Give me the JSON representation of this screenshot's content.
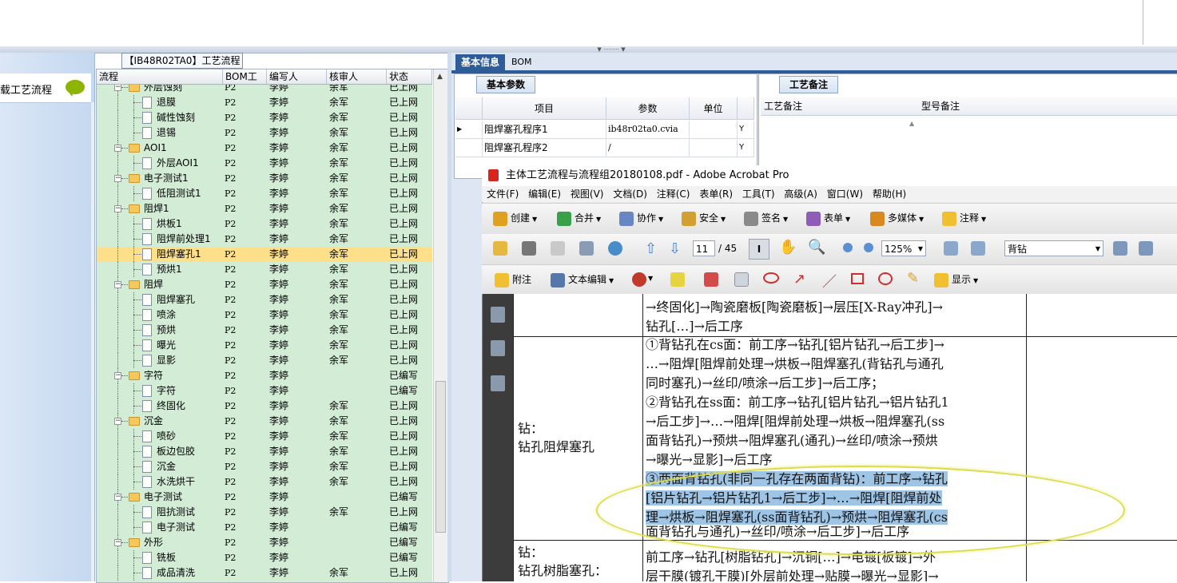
{
  "process_grid": {
    "title": "【IB48R02TA0】工艺流程",
    "left_item_label": "载工艺流程",
    "columns": [
      "流程",
      "BOM工厂",
      "编写人",
      "核审人",
      "状态"
    ],
    "rows": [
      {
        "level": 0,
        "type": "folder",
        "name": "外层蚀刻",
        "factory": "P2",
        "writer": "李婷",
        "reviewer": "余军",
        "status": "已上网"
      },
      {
        "level": 1,
        "type": "doc",
        "name": "退膜",
        "factory": "P2",
        "writer": "李婷",
        "reviewer": "余军",
        "status": "已上网"
      },
      {
        "level": 1,
        "type": "doc",
        "name": "碱性蚀刻",
        "factory": "P2",
        "writer": "李婷",
        "reviewer": "余军",
        "status": "已上网"
      },
      {
        "level": 1,
        "type": "doc",
        "name": "退锡",
        "factory": "P2",
        "writer": "李婷",
        "reviewer": "余军",
        "status": "已上网"
      },
      {
        "level": 0,
        "type": "folder",
        "name": "AOI1",
        "factory": "P2",
        "writer": "李婷",
        "reviewer": "余军",
        "status": "已上网"
      },
      {
        "level": 1,
        "type": "doc",
        "name": "外层AOI1",
        "factory": "P2",
        "writer": "李婷",
        "reviewer": "余军",
        "status": "已上网"
      },
      {
        "level": 0,
        "type": "folder",
        "name": "电子测试1",
        "factory": "P2",
        "writer": "李婷",
        "reviewer": "余军",
        "status": "已上网"
      },
      {
        "level": 1,
        "type": "doc",
        "name": "低阻测试1",
        "factory": "P2",
        "writer": "李婷",
        "reviewer": "余军",
        "status": "已上网"
      },
      {
        "level": 0,
        "type": "folder",
        "name": "阻焊1",
        "factory": "P2",
        "writer": "李婷",
        "reviewer": "余军",
        "status": "已上网"
      },
      {
        "level": 1,
        "type": "doc",
        "name": "烘板1",
        "factory": "P2",
        "writer": "李婷",
        "reviewer": "余军",
        "status": "已上网"
      },
      {
        "level": 1,
        "type": "doc",
        "name": "阻焊前处理1",
        "factory": "P2",
        "writer": "李婷",
        "reviewer": "余军",
        "status": "已上网"
      },
      {
        "level": 1,
        "type": "doc",
        "name": "阻焊塞孔1",
        "factory": "P2",
        "writer": "李婷",
        "reviewer": "余军",
        "status": "已上网",
        "selected": true
      },
      {
        "level": 1,
        "type": "doc",
        "name": "预烘1",
        "factory": "P2",
        "writer": "李婷",
        "reviewer": "余军",
        "status": "已上网"
      },
      {
        "level": 0,
        "type": "folder",
        "name": "阻焊",
        "factory": "P2",
        "writer": "李婷",
        "reviewer": "余军",
        "status": "已上网"
      },
      {
        "level": 1,
        "type": "doc",
        "name": "阻焊塞孔",
        "factory": "P2",
        "writer": "李婷",
        "reviewer": "余军",
        "status": "已上网"
      },
      {
        "level": 1,
        "type": "doc",
        "name": "喷涂",
        "factory": "P2",
        "writer": "李婷",
        "reviewer": "余军",
        "status": "已上网"
      },
      {
        "level": 1,
        "type": "doc",
        "name": "预烘",
        "factory": "P2",
        "writer": "李婷",
        "reviewer": "余军",
        "status": "已上网"
      },
      {
        "level": 1,
        "type": "doc",
        "name": "曝光",
        "factory": "P2",
        "writer": "李婷",
        "reviewer": "余军",
        "status": "已上网"
      },
      {
        "level": 1,
        "type": "doc",
        "name": "显影",
        "factory": "P2",
        "writer": "李婷",
        "reviewer": "余军",
        "status": "已上网"
      },
      {
        "level": 0,
        "type": "folder",
        "name": "字符",
        "factory": "P2",
        "writer": "李婷",
        "reviewer": "",
        "status": "已编写"
      },
      {
        "level": 1,
        "type": "doc",
        "name": "字符",
        "factory": "P2",
        "writer": "李婷",
        "reviewer": "",
        "status": "已编写"
      },
      {
        "level": 1,
        "type": "doc",
        "name": "终固化",
        "factory": "P2",
        "writer": "李婷",
        "reviewer": "余军",
        "status": "已上网"
      },
      {
        "level": 0,
        "type": "folder",
        "name": "沉金",
        "factory": "P2",
        "writer": "李婷",
        "reviewer": "余军",
        "status": "已上网"
      },
      {
        "level": 1,
        "type": "doc",
        "name": "喷砂",
        "factory": "P2",
        "writer": "李婷",
        "reviewer": "余军",
        "status": "已上网"
      },
      {
        "level": 1,
        "type": "doc",
        "name": "板边包胶",
        "factory": "P2",
        "writer": "李婷",
        "reviewer": "余军",
        "status": "已上网"
      },
      {
        "level": 1,
        "type": "doc",
        "name": "沉金",
        "factory": "P2",
        "writer": "李婷",
        "reviewer": "余军",
        "status": "已上网"
      },
      {
        "level": 1,
        "type": "doc",
        "name": "水洗烘干",
        "factory": "P2",
        "writer": "李婷",
        "reviewer": "余军",
        "status": "已上网"
      },
      {
        "level": 0,
        "type": "folder",
        "name": "电子测试",
        "factory": "P2",
        "writer": "李婷",
        "reviewer": "",
        "status": "已编写"
      },
      {
        "level": 1,
        "type": "doc",
        "name": "阻抗测试",
        "factory": "P2",
        "writer": "李婷",
        "reviewer": "余军",
        "status": "已上网"
      },
      {
        "level": 1,
        "type": "doc",
        "name": "电子测试",
        "factory": "P2",
        "writer": "李婷",
        "reviewer": "",
        "status": "已编写"
      },
      {
        "level": 0,
        "type": "folder",
        "name": "外形",
        "factory": "P2",
        "writer": "李婷",
        "reviewer": "",
        "status": "已编写"
      },
      {
        "level": 1,
        "type": "doc",
        "name": "铣板",
        "factory": "P2",
        "writer": "李婷",
        "reviewer": "",
        "status": "已编写"
      },
      {
        "level": 1,
        "type": "doc",
        "name": "成品清洗",
        "factory": "P2",
        "writer": "李婷",
        "reviewer": "余军",
        "status": "已上网"
      }
    ]
  },
  "right_tabs": {
    "basic": "基本信息",
    "bom": "BOM"
  },
  "params": {
    "tab": "基本参数",
    "headers": [
      "项目",
      "参数",
      "单位"
    ],
    "rows": [
      {
        "item": "阻焊塞孔程序1",
        "value": "ib48r02ta0.cvia",
        "unit": "",
        "flag": "Y"
      },
      {
        "item": "阻焊塞孔程序2",
        "value": "/",
        "unit": "",
        "flag": "Y"
      }
    ]
  },
  "notes": {
    "tab": "工艺备注",
    "col1": "工艺备注",
    "col2": "型号备注"
  },
  "acrobat": {
    "title": "主体工艺流程与流程组20180108.pdf - Adobe Acrobat Pro",
    "menu": [
      "文件(F)",
      "编辑(E)",
      "视图(V)",
      "文档(D)",
      "注释(C)",
      "表单(R)",
      "工具(T)",
      "高级(A)",
      "窗口(W)",
      "帮助(H)"
    ],
    "toolbar1": [
      "创建",
      "合并",
      "协作",
      "安全",
      "签名",
      "表单",
      "多媒体",
      "注释"
    ],
    "page_current": "11",
    "page_total": "/ 45",
    "zoom": "125%",
    "search_value": "背钻",
    "toolbar3": {
      "attach": "附注",
      "text_edit": "文本编辑",
      "show": "显示"
    }
  },
  "document": {
    "top_lines": [
      "→终固化]→陶瓷磨板[陶瓷磨板]→层压[X-Ray冲孔]→",
      "钻孔[…]→后工序"
    ],
    "row2_label": [
      "钻：",
      "钻孔阻焊塞孔"
    ],
    "row2_lines": [
      "①背钻孔在cs面：前工序→钻孔[铝片钻孔→后工步]→",
      "…→阻焊[阻焊前处理→烘板→阻焊塞孔(背钻孔与通孔",
      "同时塞孔)→丝印/喷涂→后工步]→后工序；",
      "②背钻孔在ss面：前工序→钻孔[铝片钻孔→铝片钻孔1",
      "→后工步]→…→阻焊[阻焊前处理→烘板→阻焊塞孔(ss",
      "面背钻孔)→预烘→阻焊塞孔(通孔)→丝印/喷涂→预烘",
      "→曝光→显影]→后工序",
      "③两面背钻孔(非同一孔存在两面背钻)：前工序→钻孔",
      "[铝片钻孔→铝片钻孔1→后工步]→…→阻焊[阻焊前处",
      "理→烘板→阻焊塞孔(ss面背钻孔)→预烘→阻焊塞孔(cs",
      "面背钻孔与通孔)→丝印/喷涂→后工步]→后工序"
    ],
    "row3_label": [
      "钻：",
      "钻孔树脂塞孔："
    ],
    "row3_lines": [
      "前工序→钻孔[树脂钻孔]→沉铜[…]→电镀[板镀]→外",
      "层干膜(镀孔干膜)[外层前处理→贴膜→曝光→显影]→"
    ]
  }
}
